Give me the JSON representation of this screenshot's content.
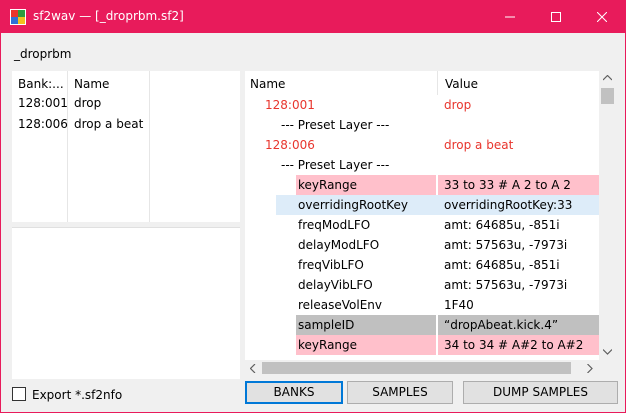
{
  "window": {
    "title": "sf2wav — [_droprbm.sf2]"
  },
  "colors": {
    "accent": "#e81b5b",
    "red_text": "#e8352d",
    "pink_row": "#ffc0cb",
    "selected_row": "#ddecf9",
    "gray_row": "#c0c0c0"
  },
  "file_label": "_droprbm",
  "banks": {
    "columns": [
      "Bank:...",
      "Name"
    ],
    "rows": [
      {
        "bank": "128:001",
        "name": "drop"
      },
      {
        "bank": "128:006",
        "name": "drop a beat"
      }
    ]
  },
  "tree": {
    "columns": [
      "Name",
      "Value"
    ],
    "rows": [
      {
        "name": "128:001",
        "value": "drop",
        "style": "red"
      },
      {
        "name": "--- Preset Layer ---",
        "value": "",
        "style": "plain"
      },
      {
        "name": "128:006",
        "value": "drop a beat",
        "style": "red"
      },
      {
        "name": "--- Preset Layer ---",
        "value": "",
        "style": "plain"
      },
      {
        "name": "keyRange",
        "value": "33 to 33 # A 2 to A 2",
        "style": "pink"
      },
      {
        "name": "overridingRootKey",
        "value": "overridingRootKey:33",
        "style": "selected"
      },
      {
        "name": "freqModLFO",
        "value": "amt: 64685u, -851i",
        "style": "plain"
      },
      {
        "name": "delayModLFO",
        "value": "amt: 57563u, -7973i",
        "style": "plain"
      },
      {
        "name": "freqVibLFO",
        "value": "amt: 64685u, -851i",
        "style": "plain"
      },
      {
        "name": "delayVibLFO",
        "value": "amt: 57563u, -7973i",
        "style": "plain"
      },
      {
        "name": "releaseVolEnv",
        "value": "1F40",
        "style": "plain"
      },
      {
        "name": "sampleID",
        "value": "“dropAbeat.kick.4”",
        "style": "gray"
      },
      {
        "name": "keyRange",
        "value": "34 to 34 # A#2 to A#2",
        "style": "pink"
      }
    ]
  },
  "export_label": "Export *.sf2nfo",
  "buttons": {
    "banks": "BANKS",
    "samples": "SAMPLES",
    "dump": "DUMP SAMPLES"
  }
}
